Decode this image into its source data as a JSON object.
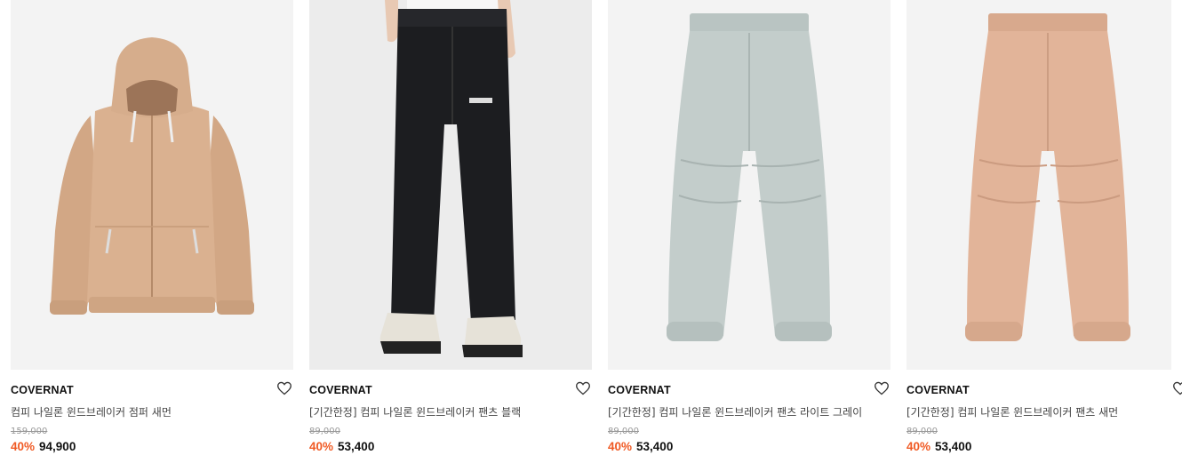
{
  "products": [
    {
      "brand": "COVERNAT",
      "name": "컴피 나일론 윈드브레이커 점퍼 새먼",
      "original_price": "159,000",
      "discount": "40%",
      "sale_price": "94,900",
      "image_colors": {
        "bg": "#f3f3f3",
        "main": "#d9b08f",
        "shade": "#b98e6d"
      },
      "wishlist_icon": "heart-outline-icon"
    },
    {
      "brand": "COVERNAT",
      "name": "[기간한정] 컴피 나일론 윈드브레이커 팬츠 블랙",
      "original_price": "89,000",
      "discount": "40%",
      "sale_price": "53,400",
      "image_colors": {
        "bg": "#ececec",
        "main": "#1c1d20",
        "shade": "#2e3035"
      },
      "wishlist_icon": "heart-outline-icon"
    },
    {
      "brand": "COVERNAT",
      "name": "[기간한정] 컴피 나일론 윈드브레이커 팬츠 라이트 그레이",
      "original_price": "89,000",
      "discount": "40%",
      "sale_price": "53,400",
      "image_colors": {
        "bg": "#f3f3f3",
        "main": "#c3cdcb",
        "shade": "#a8b3b1"
      },
      "wishlist_icon": "heart-outline-icon"
    },
    {
      "brand": "COVERNAT",
      "name": "[기간한정] 컴피 나일론 윈드브레이커 팬츠 새먼",
      "original_price": "89,000",
      "discount": "40%",
      "sale_price": "53,400",
      "image_colors": {
        "bg": "#f3f3f3",
        "main": "#e2b499",
        "shade": "#cb9b80"
      },
      "wishlist_icon": "heart-outline-icon"
    }
  ],
  "accent_color": "#f05a24"
}
